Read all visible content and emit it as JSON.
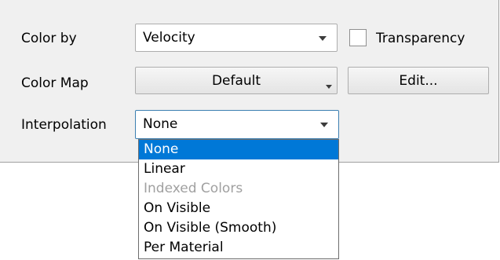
{
  "rows": {
    "color_by": {
      "label": "Color by",
      "value": "Velocity"
    },
    "transparency": {
      "label": "Transparency",
      "checked": false
    },
    "color_map": {
      "label": "Color Map",
      "value": "Default",
      "edit_label": "Edit..."
    },
    "interpolation": {
      "label": "Interpolation",
      "value": "None"
    }
  },
  "interpolation_options": [
    {
      "label": "None",
      "state": "selected"
    },
    {
      "label": "Linear",
      "state": "normal"
    },
    {
      "label": "Indexed Colors",
      "state": "disabled"
    },
    {
      "label": "On Visible",
      "state": "normal"
    },
    {
      "label": "On Visible (Smooth)",
      "state": "normal"
    },
    {
      "label": "Per Material",
      "state": "normal"
    }
  ],
  "colors": {
    "panel_bg": "#f0f0f0",
    "selection": "#0078d7",
    "focus_border": "#3c7fb1",
    "disabled_text": "#a0a0a0"
  },
  "icons": {
    "dropdown_arrow": "chevron-down-icon"
  }
}
